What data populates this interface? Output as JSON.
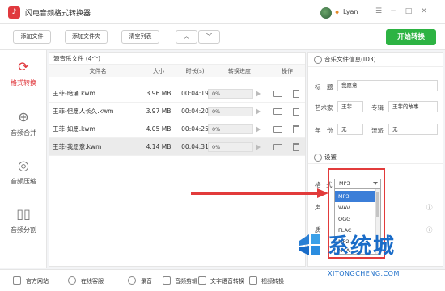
{
  "app": {
    "title": "闪电音频格式转换器",
    "logo_text": "♪"
  },
  "user": {
    "name": "Lyan"
  },
  "window_controls": [
    "☰",
    "−",
    "□",
    "✕"
  ],
  "toolbar": {
    "add_file": "添加文件",
    "add_folder": "添加文件夹",
    "clear_list": "清空列表",
    "up": "︿",
    "down": "﹀",
    "start": "开始转换"
  },
  "sidebar": [
    {
      "label": "格式转换",
      "icon": "⟳",
      "active": true
    },
    {
      "label": "音频合并",
      "icon": "⊕"
    },
    {
      "label": "音频压缩",
      "icon": "◎"
    },
    {
      "label": "音频分割",
      "icon": "▯▯"
    }
  ],
  "files": {
    "header": "源音乐文件 (4个)",
    "columns": [
      "文件名",
      "大小",
      "时长(s)",
      "转换进度",
      "操作"
    ],
    "rows": [
      {
        "name": "王菲-暗涌.kwm",
        "size": "3.96 MB",
        "duration": "00:04:19",
        "progress": "0%"
      },
      {
        "name": "王菲-但愿人长久.kwm",
        "size": "3.97 MB",
        "duration": "00:04:20",
        "progress": "0%"
      },
      {
        "name": "王菲-如愿.kwm",
        "size": "4.05 MB",
        "duration": "00:04:25",
        "progress": "0%"
      },
      {
        "name": "王菲-我愿意.kwm",
        "size": "4.14 MB",
        "duration": "00:04:31",
        "progress": "0%"
      }
    ]
  },
  "id3": {
    "title": "音乐文件信息(ID3)",
    "label_title": "标　题",
    "value_title": "我愿意",
    "label_artist": "艺术家",
    "value_artist": "王菲",
    "label_album": "专辑",
    "value_album": "王菲的故事",
    "label_year": "年　份",
    "value_year": "无",
    "label_genre": "流派",
    "value_genre": "无"
  },
  "settings": {
    "title": "设置",
    "label_format": "格",
    "label_format2": "式",
    "label_channel": "声",
    "label_quality": "质",
    "format_value": "MP3",
    "options": [
      "MP3",
      "WAV",
      "OGG",
      "FLAC",
      "MP2",
      "M4A"
    ],
    "highlighted": "MP3"
  },
  "bottom": [
    "官方网站",
    "在线客服",
    "录音",
    "音频剪辑",
    "文字语音转换",
    "视频转换"
  ],
  "watermark": {
    "text": "系统城",
    "url": "XITONGCHENG.COM"
  }
}
